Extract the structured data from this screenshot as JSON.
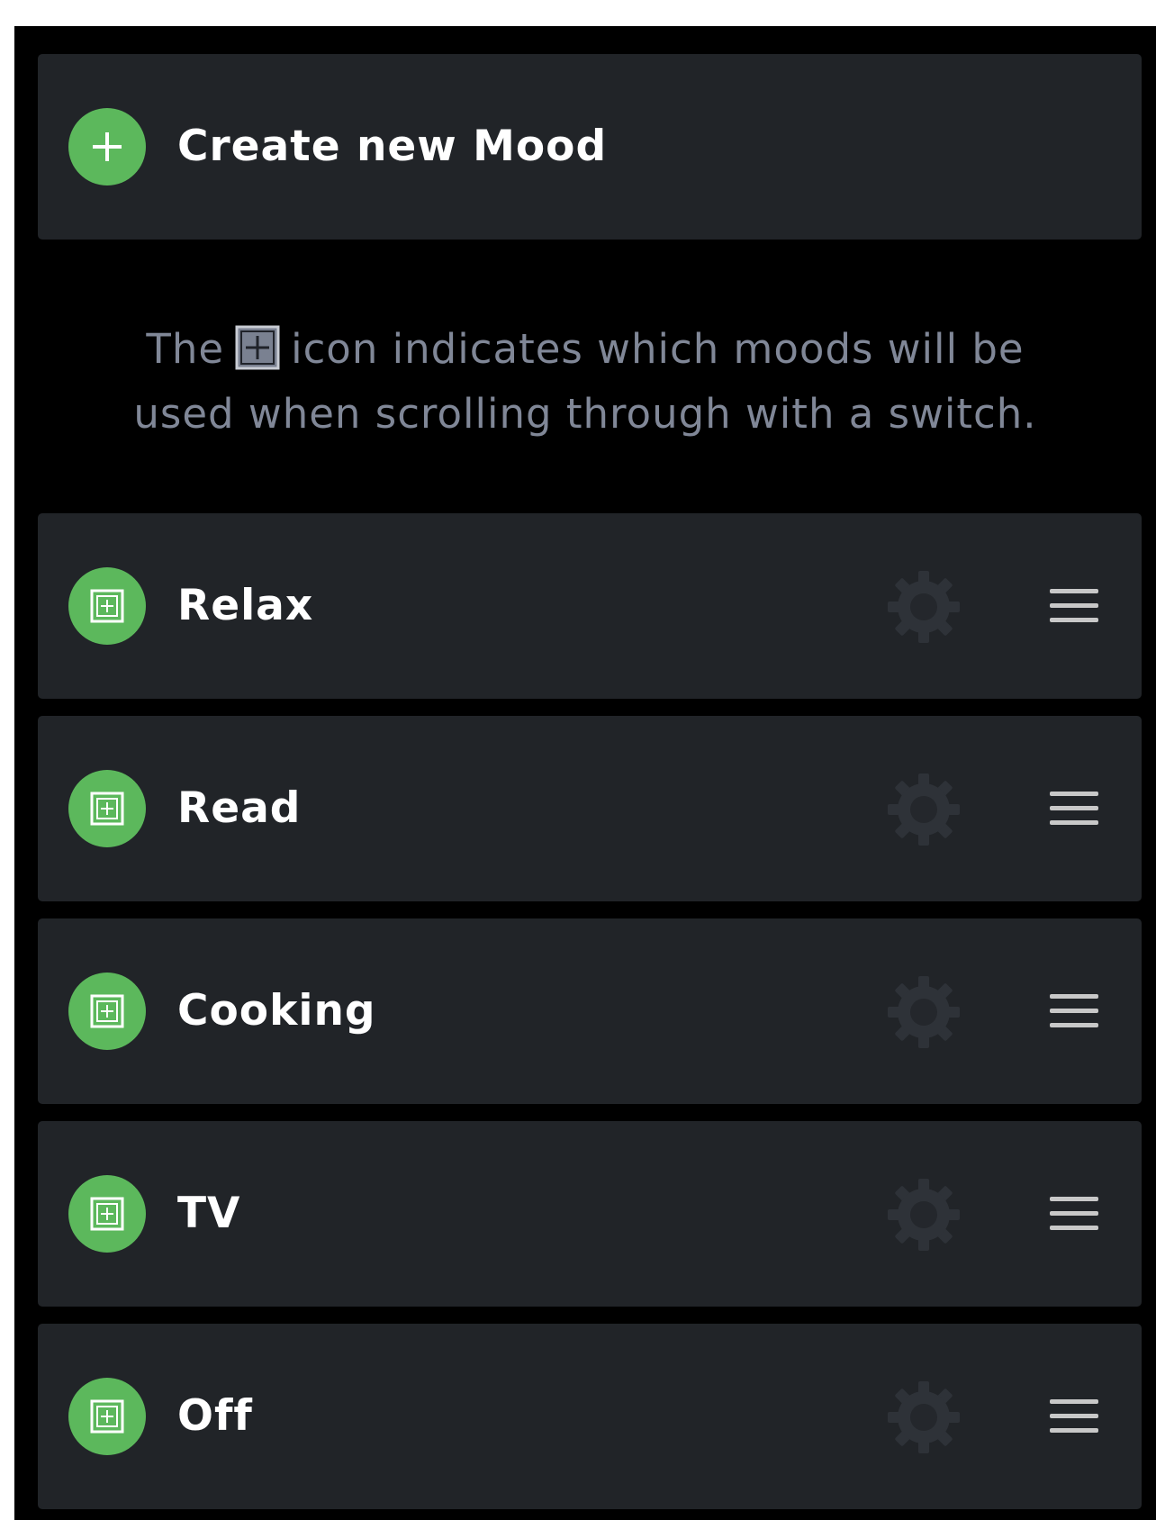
{
  "create": {
    "label": "Create new Mood",
    "icon": "plus-icon"
  },
  "info": {
    "before": "The",
    "icon": "switch-scroll-icon",
    "line1_after": "icon indicates which moods will be",
    "line2": "used when scrolling through with a switch."
  },
  "moods": [
    {
      "label": "Relax",
      "scroll_icon": "switch-scroll-icon",
      "settings_icon": "gear-icon",
      "drag_icon": "drag-handle-icon"
    },
    {
      "label": "Read",
      "scroll_icon": "switch-scroll-icon",
      "settings_icon": "gear-icon",
      "drag_icon": "drag-handle-icon"
    },
    {
      "label": "Cooking",
      "scroll_icon": "switch-scroll-icon",
      "settings_icon": "gear-icon",
      "drag_icon": "drag-handle-icon"
    },
    {
      "label": "TV",
      "scroll_icon": "switch-scroll-icon",
      "settings_icon": "gear-icon",
      "drag_icon": "drag-handle-icon"
    },
    {
      "label": "Off",
      "scroll_icon": "switch-scroll-icon",
      "settings_icon": "gear-icon",
      "drag_icon": "drag-handle-icon"
    }
  ],
  "colors": {
    "background": "#000000",
    "card": "#212428",
    "accent_green": "#5cb85c",
    "info_text": "#808797",
    "gear": "#2e3238",
    "menu": "#c8c8c8"
  }
}
